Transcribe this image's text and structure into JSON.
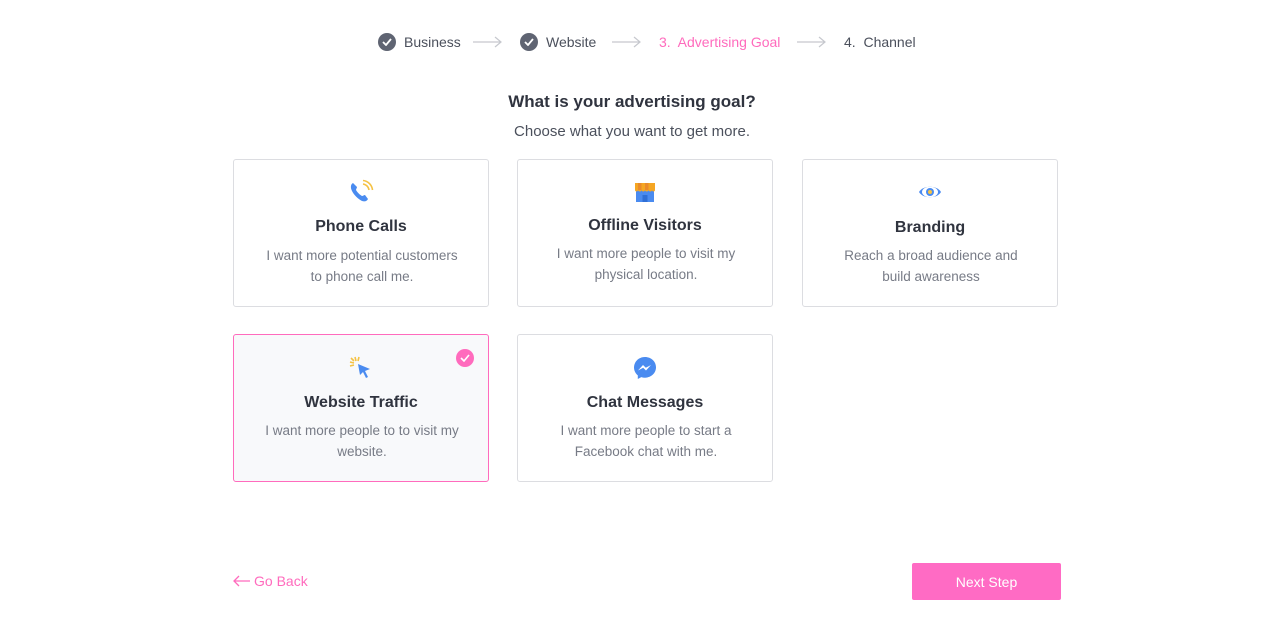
{
  "stepper": {
    "steps": [
      {
        "label": "Business",
        "state": "done"
      },
      {
        "label": "Website",
        "state": "done"
      },
      {
        "label": "3.  Advertising Goal",
        "state": "active"
      },
      {
        "label": "4.  Channel",
        "state": "upcoming"
      }
    ]
  },
  "main": {
    "heading": "What is your advertising goal?",
    "subheading": "Choose what you want to get more."
  },
  "goals": [
    {
      "title": "Phone Calls",
      "desc1": "I want more potential customers",
      "desc2": "to phone call me.",
      "icon": "phone-icon",
      "selected": false
    },
    {
      "title": "Offline Visitors",
      "desc1": "I want more people to visit my",
      "desc2": "physical location.",
      "icon": "store-icon",
      "selected": false
    },
    {
      "title": "Branding",
      "desc1": "Reach a broad audience and",
      "desc2": "build awareness",
      "icon": "eye-icon",
      "selected": false
    },
    {
      "title": "Website Traffic",
      "desc1": "I want more people to to visit my",
      "desc2": "website.",
      "icon": "cursor-click-icon",
      "selected": true
    },
    {
      "title": "Chat Messages",
      "desc1": "I want more people to start a",
      "desc2": "Facebook chat with me.",
      "icon": "messenger-icon",
      "selected": false
    }
  ],
  "footer": {
    "back_label": "Go Back",
    "next_label": "Next Step"
  },
  "colors": {
    "accent": "#ff6bbd",
    "done_step": "#5f6472",
    "icon_blue": "#4a8bf0",
    "icon_yellow": "#f5c243"
  }
}
